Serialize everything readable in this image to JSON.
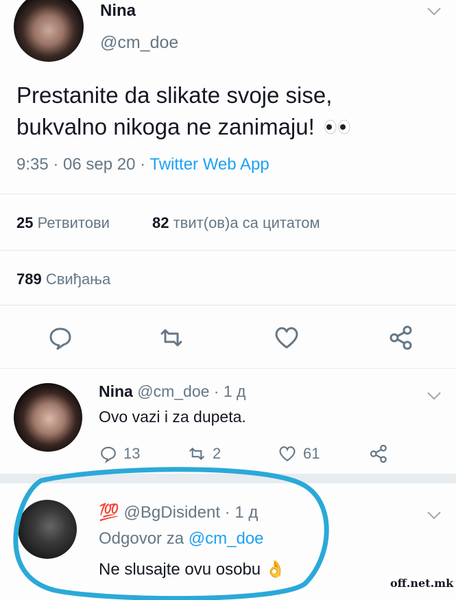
{
  "main_tweet": {
    "author_name": "Nina",
    "author_handle": "@cm_doe",
    "text_line1": "Prestanite da slikate svoje sise,",
    "text_line2": "bukvalno nikoga ne zanimaju!",
    "time": "9:35 · 06 sep 20 · ",
    "app": "Twitter Web App",
    "retweets_count": "25",
    "retweets_label": "Ретвитови",
    "quotes_count": "82",
    "quotes_label": "твит(ов)а са цитатом",
    "likes_count": "789",
    "likes_label": "Свиђања"
  },
  "reply1": {
    "author_name": "Nina",
    "meta": " @cm_doe · 1 д",
    "text": "Ovo vazi i za dupeta.",
    "replies": "13",
    "retweets": "2",
    "likes": "61"
  },
  "reply2": {
    "badge": "💯",
    "meta": " @BgDisident · 1 д",
    "replying_prefix": "Odgovor za ",
    "replying_handle": "@cm_doe",
    "text": "Ne slusajte ovu osobu ",
    "emoji": "👌"
  },
  "watermark": "off.net.mk",
  "colors": {
    "accent": "#1da1f2",
    "highlight_circle": "#2aa9d8",
    "secondary_text": "#657786"
  },
  "icons": [
    "chevron-down-icon",
    "reply-icon",
    "retweet-icon",
    "like-icon",
    "share-icon",
    "eyes-emoji",
    "ok-hand-emoji",
    "hundred-points-emoji"
  ]
}
